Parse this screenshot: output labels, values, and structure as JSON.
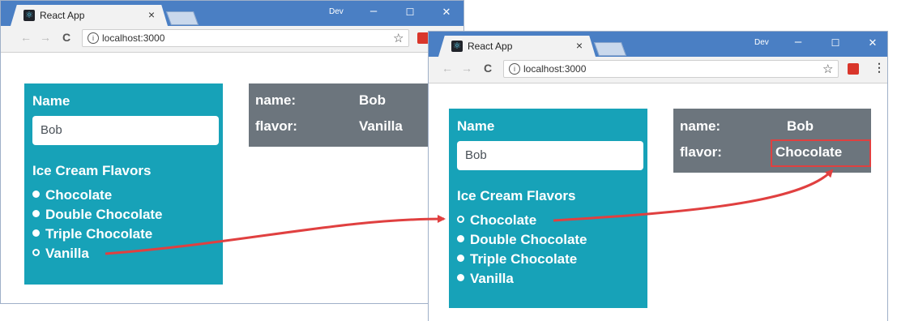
{
  "windows": [
    {
      "tab_title": "React App",
      "tab_close": "×",
      "profile": "Dev",
      "controls": {
        "minimize": "–",
        "maximize": "☐",
        "close": "✕"
      },
      "nav": {
        "back": "←",
        "forward": "→",
        "reload": "C"
      },
      "url": "localhost:3000",
      "info_icon": "i",
      "star": "☆",
      "form": {
        "name_label": "Name",
        "name_value": "Bob",
        "flavors_label": "Ice Cream Flavors",
        "flavors": [
          "Chocolate",
          "Double Chocolate",
          "Triple Chocolate",
          "Vanilla"
        ],
        "selected": "Vanilla"
      },
      "summary": {
        "name_key": "name:",
        "name_value": "Bob",
        "flavor_key": "flavor:",
        "flavor_value": "Vanilla"
      }
    },
    {
      "tab_title": "React App",
      "tab_close": "×",
      "profile": "Dev",
      "controls": {
        "minimize": "–",
        "maximize": "☐",
        "close": "✕"
      },
      "nav": {
        "back": "←",
        "forward": "→",
        "reload": "C"
      },
      "url": "localhost:3000",
      "info_icon": "i",
      "star": "☆",
      "menu": "⋮",
      "form": {
        "name_label": "Name",
        "name_value": "Bob",
        "flavors_label": "Ice Cream Flavors",
        "flavors": [
          "Chocolate",
          "Double Chocolate",
          "Triple Chocolate",
          "Vanilla"
        ],
        "selected": "Chocolate"
      },
      "summary": {
        "name_key": "name:",
        "name_value": "Bob",
        "flavor_key": "flavor:",
        "flavor_value": "Chocolate"
      }
    }
  ],
  "colors": {
    "titlebar": "#4a7fc4",
    "form_bg": "#17a2b8",
    "summary_bg": "#6c757d",
    "annotation": "#e04040"
  }
}
